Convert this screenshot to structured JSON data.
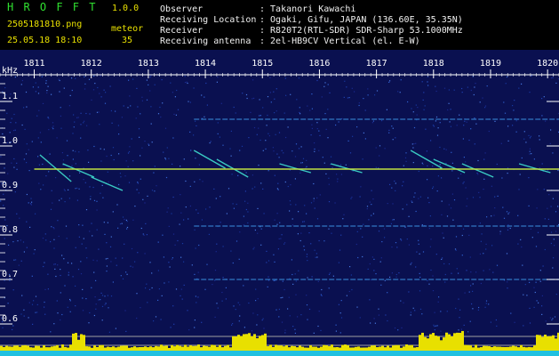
{
  "header": {
    "app_name": "H R O F F T",
    "version": "1.0.0",
    "filename": "2505181810.png",
    "meteor_label": "meteor",
    "datetime": "25.05.18 18:10",
    "meteor_count": "35",
    "info": [
      {
        "label": "Observer",
        "value": ": Takanori Kawachi"
      },
      {
        "label": "Receiving Location",
        "value": ": Ogaki, Gifu, JAPAN (136.60E, 35.35N)"
      },
      {
        "label": "Receiver",
        "value": ": R820T2(RTL-SDR) SDR-Sharp 53.1000MHz"
      },
      {
        "label": "Receiving antenna",
        "value": ": 2el-HB9CV Vertical (el. E-W)"
      }
    ]
  },
  "colors": {
    "green": "#30e030",
    "yellow": "#e8e000",
    "background": "#0a1050"
  },
  "chart_data": {
    "type": "heatmap",
    "ylabel": "kHz",
    "x_ticks": [
      "1811",
      "1812",
      "1813",
      "1814",
      "1815",
      "1816",
      "1817",
      "1818",
      "1819",
      "1820"
    ],
    "y_ticks": [
      "1.1",
      "1.0",
      "0.9",
      "0.8",
      "0.7",
      "0.6"
    ],
    "ylim": [
      0.58,
      1.16
    ],
    "xlim": [
      1810.4,
      1820.2
    ],
    "carrier_khz": 0.948,
    "horizontal_lines_khz": [
      1.06,
      0.82,
      0.7
    ],
    "meteor_echoes": [
      {
        "minute": 1811.1,
        "from_khz": 0.98,
        "to_khz": 0.92
      },
      {
        "minute": 1811.5,
        "from_khz": 0.96,
        "to_khz": 0.93
      },
      {
        "minute": 1812.0,
        "from_khz": 0.93,
        "to_khz": 0.9
      },
      {
        "minute": 1813.8,
        "from_khz": 0.99,
        "to_khz": 0.95
      },
      {
        "minute": 1814.2,
        "from_khz": 0.97,
        "to_khz": 0.93
      },
      {
        "minute": 1815.3,
        "from_khz": 0.96,
        "to_khz": 0.94
      },
      {
        "minute": 1816.2,
        "from_khz": 0.96,
        "to_khz": 0.94
      },
      {
        "minute": 1817.6,
        "from_khz": 0.99,
        "to_khz": 0.95
      },
      {
        "minute": 1818.0,
        "from_khz": 0.97,
        "to_khz": 0.94
      },
      {
        "minute": 1818.5,
        "from_khz": 0.96,
        "to_khz": 0.93
      },
      {
        "minute": 1819.5,
        "from_khz": 0.96,
        "to_khz": 0.94
      }
    ],
    "grid": false
  }
}
